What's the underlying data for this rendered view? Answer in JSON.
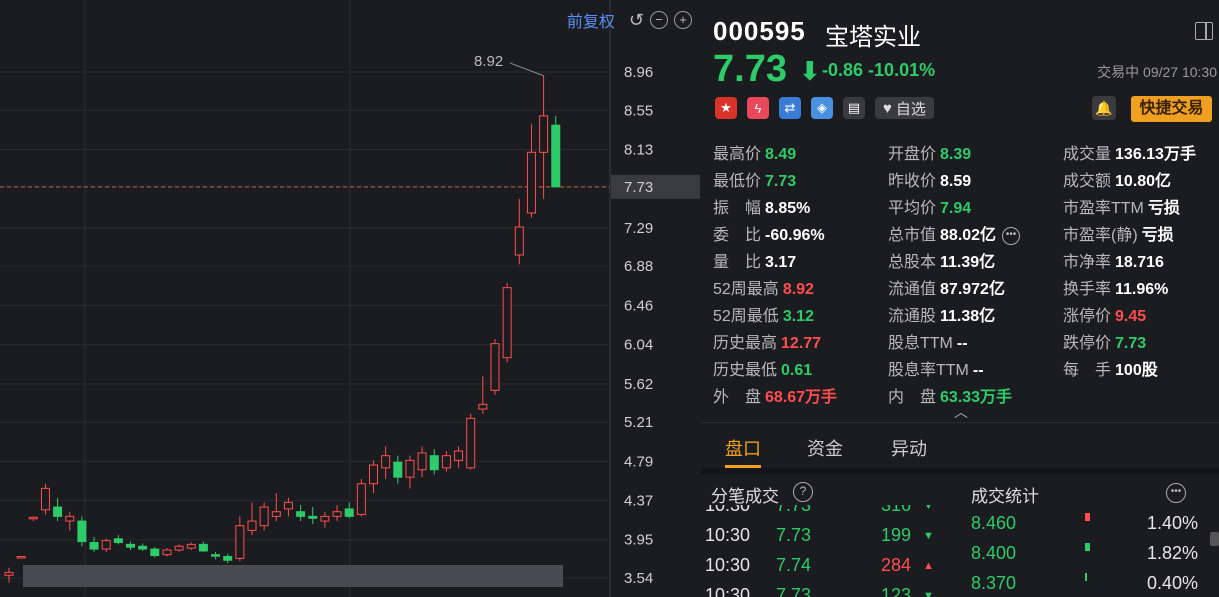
{
  "toolbar": {
    "adjust_label": "前复权",
    "undo_icon": "undo-icon",
    "zoom_out_icon": "zoom-out-icon",
    "zoom_in_icon": "zoom-in-icon"
  },
  "stock": {
    "code": "000595",
    "name": "宝塔实业",
    "price": "7.73",
    "change": "-0.86",
    "change_pct": "-10.01%",
    "status": "交易中 09/27 10:30"
  },
  "badges": {
    "watch_label": "自选",
    "quick_trade_label": "快捷交易"
  },
  "colors": {
    "up": "#ff4d4f",
    "down": "#2ecb6b",
    "accent": "#f0a020",
    "link": "#5b8ff9"
  },
  "stats": [
    [
      {
        "label": "最高价",
        "value": "8.49",
        "c": "down"
      },
      {
        "label": "开盘价",
        "value": "8.39",
        "c": "down"
      },
      {
        "label": "成交量",
        "value": "136.13万手",
        "c": "white"
      }
    ],
    [
      {
        "label": "最低价",
        "value": "7.73",
        "c": "down"
      },
      {
        "label": "昨收价",
        "value": "8.59",
        "c": "white"
      },
      {
        "label": "成交额",
        "value": "10.80亿",
        "c": "white"
      }
    ],
    [
      {
        "label": "振　幅",
        "value": "8.85%",
        "c": "white"
      },
      {
        "label": "平均价",
        "value": "7.94",
        "c": "down"
      },
      {
        "label": "市盈率TTM",
        "value": "亏损",
        "c": "white"
      }
    ],
    [
      {
        "label": "委　比",
        "value": "-60.96%",
        "c": "white"
      },
      {
        "label": "总市值",
        "value": "88.02亿",
        "c": "white"
      },
      {
        "label": "市盈率(静)",
        "value": "亏损",
        "c": "white"
      }
    ],
    [
      {
        "label": "量　比",
        "value": "3.17",
        "c": "white"
      },
      {
        "label": "总股本",
        "value": "11.39亿",
        "c": "white"
      },
      {
        "label": "市净率",
        "value": "18.716",
        "c": "white"
      }
    ],
    [
      {
        "label": "52周最高",
        "value": "8.92",
        "c": "up"
      },
      {
        "label": "流通值",
        "value": "87.972亿",
        "c": "white"
      },
      {
        "label": "换手率",
        "value": "11.96%",
        "c": "white"
      }
    ],
    [
      {
        "label": "52周最低",
        "value": "3.12",
        "c": "down"
      },
      {
        "label": "流通股",
        "value": "11.38亿",
        "c": "white"
      },
      {
        "label": "涨停价",
        "value": "9.45",
        "c": "up"
      }
    ],
    [
      {
        "label": "历史最高",
        "value": "12.77",
        "c": "up"
      },
      {
        "label": "股息TTM",
        "value": "--",
        "c": "white"
      },
      {
        "label": "跌停价",
        "value": "7.73",
        "c": "down"
      }
    ],
    [
      {
        "label": "历史最低",
        "value": "0.61",
        "c": "down"
      },
      {
        "label": "股息率TTM",
        "value": "--",
        "c": "white"
      },
      {
        "label": "每　手",
        "value": "100股",
        "c": "white"
      }
    ],
    [
      {
        "label": "外　盘",
        "value": "68.67万手",
        "c": "up"
      },
      {
        "label": "内　盘",
        "value": "63.33万手",
        "c": "down"
      }
    ]
  ],
  "tabs": [
    "盘口",
    "资金",
    "异动"
  ],
  "ticks_title": "分笔成交",
  "ticks": [
    {
      "time": "10:30",
      "price": "7.73",
      "vol": "316",
      "dir": "down"
    },
    {
      "time": "10:30",
      "price": "7.73",
      "vol": "199",
      "dir": "down"
    },
    {
      "time": "10:30",
      "price": "7.74",
      "vol": "284",
      "dir": "up"
    },
    {
      "time": "10:30",
      "price": "7.73",
      "vol": "123",
      "dir": "down"
    }
  ],
  "dist_title": "成交统计",
  "dist": [
    {
      "price": "8.460",
      "pct": "1.40%",
      "dir": "up"
    },
    {
      "price": "8.400",
      "pct": "1.82%",
      "dir": "down"
    },
    {
      "price": "8.370",
      "pct": "0.40%",
      "dir": "down"
    }
  ],
  "chart_data": {
    "type": "candlestick",
    "y_ticks": [
      "8.96",
      "8.55",
      "8.13",
      "7.73",
      "7.29",
      "6.88",
      "6.46",
      "6.04",
      "5.62",
      "5.21",
      "4.79",
      "4.37",
      "3.95",
      "3.54"
    ],
    "current_price": "7.73",
    "max_label": "8.92",
    "ylim": [
      3.48,
      9.05
    ],
    "candles": [
      {
        "o": 3.57,
        "h": 3.65,
        "l": 3.49,
        "c": 3.6
      },
      {
        "o": 3.77,
        "h": 3.77,
        "l": 3.75,
        "c": 3.77
      },
      {
        "o": 4.18,
        "h": 4.2,
        "l": 4.15,
        "c": 4.19
      },
      {
        "o": 4.27,
        "h": 4.55,
        "l": 4.22,
        "c": 4.5
      },
      {
        "o": 4.3,
        "h": 4.4,
        "l": 4.15,
        "c": 4.2
      },
      {
        "o": 4.15,
        "h": 4.25,
        "l": 4.05,
        "c": 4.2
      },
      {
        "o": 4.15,
        "h": 4.2,
        "l": 3.88,
        "c": 3.93
      },
      {
        "o": 3.92,
        "h": 3.98,
        "l": 3.82,
        "c": 3.85
      },
      {
        "o": 3.85,
        "h": 3.96,
        "l": 3.82,
        "c": 3.94
      },
      {
        "o": 3.96,
        "h": 4.0,
        "l": 3.9,
        "c": 3.92
      },
      {
        "o": 3.9,
        "h": 3.93,
        "l": 3.84,
        "c": 3.87
      },
      {
        "o": 3.88,
        "h": 3.91,
        "l": 3.83,
        "c": 3.85
      },
      {
        "o": 3.85,
        "h": 3.87,
        "l": 3.76,
        "c": 3.78
      },
      {
        "o": 3.79,
        "h": 3.86,
        "l": 3.77,
        "c": 3.84
      },
      {
        "o": 3.84,
        "h": 3.9,
        "l": 3.82,
        "c": 3.88
      },
      {
        "o": 3.86,
        "h": 3.92,
        "l": 3.84,
        "c": 3.9
      },
      {
        "o": 3.9,
        "h": 3.93,
        "l": 3.82,
        "c": 3.83
      },
      {
        "o": 3.79,
        "h": 3.82,
        "l": 3.74,
        "c": 3.78
      },
      {
        "o": 3.77,
        "h": 3.8,
        "l": 3.7,
        "c": 3.73
      },
      {
        "o": 3.75,
        "h": 4.2,
        "l": 3.72,
        "c": 4.1
      },
      {
        "o": 4.05,
        "h": 4.35,
        "l": 4.0,
        "c": 4.15
      },
      {
        "o": 4.1,
        "h": 4.35,
        "l": 4.05,
        "c": 4.3
      },
      {
        "o": 4.2,
        "h": 4.45,
        "l": 4.15,
        "c": 4.25
      },
      {
        "o": 4.28,
        "h": 4.4,
        "l": 4.2,
        "c": 4.35
      },
      {
        "o": 4.25,
        "h": 4.32,
        "l": 4.15,
        "c": 4.2
      },
      {
        "o": 4.2,
        "h": 4.3,
        "l": 4.12,
        "c": 4.18
      },
      {
        "o": 4.15,
        "h": 4.25,
        "l": 4.08,
        "c": 4.2
      },
      {
        "o": 4.2,
        "h": 4.32,
        "l": 4.15,
        "c": 4.25
      },
      {
        "o": 4.28,
        "h": 4.35,
        "l": 4.18,
        "c": 4.2
      },
      {
        "o": 4.22,
        "h": 4.6,
        "l": 4.2,
        "c": 4.55
      },
      {
        "o": 4.55,
        "h": 4.8,
        "l": 4.45,
        "c": 4.75
      },
      {
        "o": 4.72,
        "h": 4.95,
        "l": 4.6,
        "c": 4.85
      },
      {
        "o": 4.78,
        "h": 4.85,
        "l": 4.55,
        "c": 4.62
      },
      {
        "o": 4.62,
        "h": 4.85,
        "l": 4.5,
        "c": 4.8
      },
      {
        "o": 4.7,
        "h": 4.95,
        "l": 4.62,
        "c": 4.88
      },
      {
        "o": 4.85,
        "h": 4.92,
        "l": 4.65,
        "c": 4.7
      },
      {
        "o": 4.72,
        "h": 4.9,
        "l": 4.68,
        "c": 4.85
      },
      {
        "o": 4.8,
        "h": 4.95,
        "l": 4.72,
        "c": 4.9
      },
      {
        "o": 4.72,
        "h": 5.3,
        "l": 4.7,
        "c": 5.25
      },
      {
        "o": 5.35,
        "h": 5.7,
        "l": 5.3,
        "c": 5.4
      },
      {
        "o": 5.55,
        "h": 6.1,
        "l": 5.5,
        "c": 6.05
      },
      {
        "o": 5.9,
        "h": 6.7,
        "l": 5.85,
        "c": 6.65
      },
      {
        "o": 7.0,
        "h": 7.6,
        "l": 6.9,
        "c": 7.3
      },
      {
        "o": 7.45,
        "h": 8.4,
        "l": 7.4,
        "c": 8.1
      },
      {
        "o": 8.1,
        "h": 8.92,
        "l": 7.6,
        "c": 8.49
      },
      {
        "o": 8.39,
        "h": 8.49,
        "l": 7.73,
        "c": 7.73
      }
    ]
  }
}
